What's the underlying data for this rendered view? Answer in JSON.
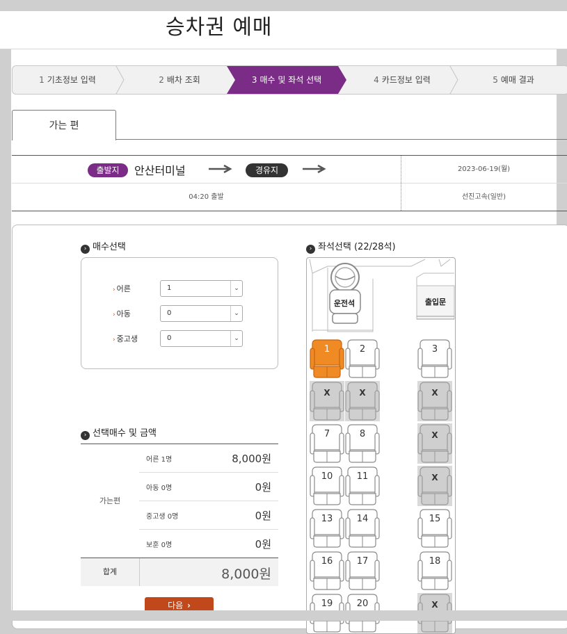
{
  "page": {
    "title": "승차권 예매"
  },
  "steps": [
    {
      "num": "1",
      "label": "기초정보 입력"
    },
    {
      "num": "2",
      "label": "배차 조회"
    },
    {
      "num": "3",
      "label": "매수 및 좌석 선택",
      "active": true
    },
    {
      "num": "4",
      "label": "카드정보 입력"
    },
    {
      "num": "5",
      "label": "예매 결과"
    }
  ],
  "tab": {
    "label": "가는 편"
  },
  "route": {
    "departure_badge": "출발지",
    "departure_name": "안산터미널",
    "via_badge": "경유지",
    "date": "2023-06-19(월)",
    "time": "04:20 출발",
    "grade": "선진고속(일반)"
  },
  "count_section": {
    "title": "매수선택",
    "rows": [
      {
        "label": "어른",
        "value": "1"
      },
      {
        "label": "아동",
        "value": "0"
      },
      {
        "label": "중고생",
        "value": "0"
      }
    ]
  },
  "price_section": {
    "title": "선택매수 및 금액",
    "trip_label": "가는편",
    "rows": [
      {
        "label": "어른 1명",
        "amount": "8,000원"
      },
      {
        "label": "아동 0명",
        "amount": "0원"
      },
      {
        "label": "중고생 0명",
        "amount": "0원"
      },
      {
        "label": "보훈 0명",
        "amount": "0원"
      }
    ],
    "total_label": "합계",
    "total_amount": "8,000원",
    "next_label": "다음"
  },
  "seat_section": {
    "title": "좌석선택 (22/28석)",
    "driver_label": "운전석",
    "door_label": "출입문",
    "selected_color": "#f08a24",
    "seats": [
      {
        "label": "1",
        "state": "selected"
      },
      {
        "label": "2",
        "state": "available"
      },
      {
        "label": "3",
        "state": "available"
      },
      {
        "label": "X",
        "state": "taken"
      },
      {
        "label": "X",
        "state": "taken"
      },
      {
        "label": "X",
        "state": "taken"
      },
      {
        "label": "7",
        "state": "available"
      },
      {
        "label": "8",
        "state": "available"
      },
      {
        "label": "X",
        "state": "taken"
      },
      {
        "label": "10",
        "state": "available"
      },
      {
        "label": "11",
        "state": "available"
      },
      {
        "label": "X",
        "state": "taken"
      },
      {
        "label": "13",
        "state": "available"
      },
      {
        "label": "14",
        "state": "available"
      },
      {
        "label": "15",
        "state": "available"
      },
      {
        "label": "16",
        "state": "available"
      },
      {
        "label": "17",
        "state": "available"
      },
      {
        "label": "18",
        "state": "available"
      },
      {
        "label": "19",
        "state": "available"
      },
      {
        "label": "20",
        "state": "available"
      },
      {
        "label": "X",
        "state": "taken"
      }
    ]
  }
}
